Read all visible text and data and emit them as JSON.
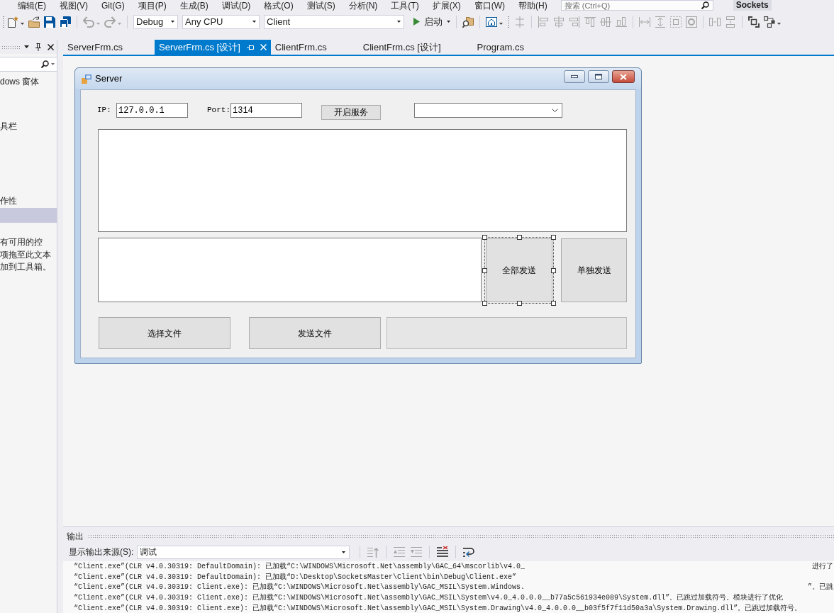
{
  "menu_bar": {
    "items": [
      "编辑(E)",
      "视图(V)",
      "Git(G)",
      "项目(P)",
      "生成(B)",
      "调试(D)",
      "格式(O)",
      "测试(S)",
      "分析(N)",
      "工具(T)",
      "扩展(X)",
      "窗口(W)",
      "帮助(H)"
    ],
    "search": {
      "placeholder": "搜索 (Ctrl+Q)"
    },
    "solution_name": "Sockets"
  },
  "toolbar": {
    "groups": [
      [
        {
          "kind": "new",
          "disabled": false,
          "dropdown": true
        },
        {
          "kind": "open",
          "disabled": false,
          "dropdown": false
        },
        {
          "kind": "save",
          "disabled": false,
          "dropdown": false
        },
        {
          "kind": "saveall",
          "disabled": false,
          "dropdown": false
        }
      ],
      [
        {
          "kind": "undo",
          "disabled": true,
          "dropdown": true
        },
        {
          "kind": "redo",
          "disabled": true,
          "dropdown": true
        }
      ],
      [
        {
          "kind": "config",
          "value": "Debug"
        },
        {
          "kind": "platform",
          "value": "Any CPU"
        },
        {
          "kind": "project",
          "value": "Client"
        },
        {
          "kind": "start",
          "label": "启动",
          "dropdown": true
        }
      ],
      [
        {
          "kind": "find",
          "disabled": false,
          "dropdown": false
        }
      ],
      [
        {
          "kind": "form",
          "disabled": false,
          "dropdown": true
        }
      ],
      [
        {
          "kind": "grid",
          "disabled": true,
          "dropdown": false
        }
      ],
      [
        {
          "kind": "alignleft",
          "disabled": true,
          "dropdown": false
        },
        {
          "kind": "aligncenter",
          "disabled": true,
          "dropdown": false
        },
        {
          "kind": "alignright",
          "disabled": true,
          "dropdown": false
        },
        {
          "kind": "aligntop",
          "disabled": true,
          "dropdown": false
        },
        {
          "kind": "alignmiddle",
          "disabled": true,
          "dropdown": false
        },
        {
          "kind": "alignbottom",
          "disabled": true,
          "dropdown": false
        }
      ],
      [
        {
          "kind": "samewidth",
          "disabled": true,
          "dropdown": false
        },
        {
          "kind": "sameheight",
          "disabled": true,
          "dropdown": false
        },
        {
          "kind": "samesize",
          "disabled": true,
          "dropdown": false
        },
        {
          "kind": "sizegrid",
          "disabled": true,
          "dropdown": false
        }
      ],
      [
        {
          "kind": "spaceh",
          "disabled": true,
          "dropdown": false
        },
        {
          "kind": "spacev",
          "disabled": true,
          "dropdown": false
        }
      ],
      [
        {
          "kind": "expand",
          "disabled": false,
          "dropdown": false
        },
        {
          "kind": "nodes",
          "disabled": false,
          "dropdown": true
        }
      ]
    ]
  },
  "toolbox": {
    "rows": [
      {
        "label": "dows 窗体",
        "selected": false
      },
      {
        "selected": false
      },
      {
        "selected": false
      },
      {
        "label": "具栏",
        "selected": false
      },
      {
        "selected": false
      },
      {
        "selected": false
      },
      {
        "selected": false
      },
      {
        "selected": false
      },
      {
        "label": "作性",
        "selected": false
      },
      {
        "selected": true
      }
    ],
    "empty_message_lines": [
      "有可用的控",
      "项拖至此文本",
      "加到工具箱。"
    ]
  },
  "tabs": [
    {
      "label": "ServerFrm.cs",
      "selected": false
    },
    {
      "label": "ServerFrm.cs [设计]",
      "selected": true
    },
    {
      "label": "ClientFrm.cs",
      "selected": false
    },
    {
      "label": "ClientFrm.cs [设计]",
      "selected": false
    },
    {
      "label": "Program.cs",
      "selected": false
    }
  ],
  "form": {
    "title": "Server",
    "ip_label": "IP:",
    "ip_value": "127.0.0.1",
    "port_label": "Port:",
    "port_value": "1314",
    "start_button": {
      "label": "开启服务",
      "selected": false
    },
    "send_all_button": {
      "label": "全部发送",
      "selected": true
    },
    "send_one_button": {
      "label": "单独发送",
      "selected": false
    },
    "choose_file_button": {
      "label": "选择文件",
      "selected": false
    },
    "send_file_button": {
      "label": "发送文件",
      "selected": false
    },
    "progress": {
      "level": 0
    }
  },
  "output": {
    "title": "输出",
    "source_label": "显示输出来源(S):",
    "source_value": "调试",
    "tools": [
      {
        "kind": "locate",
        "disabled": true
      },
      {
        "kind": "prev",
        "disabled": true
      },
      {
        "kind": "next",
        "disabled": true
      },
      {
        "kind": "clear",
        "disabled": false
      },
      {
        "kind": "wrap",
        "disabled": false
      }
    ],
    "lines": [
      {
        "text": "“Client.exe”(CLR v4.0.30319: DefaultDomain): 已加载“C:\\WINDOWS\\Microsoft.Net\\assembly\\GAC_64\\mscorlib\\v4.0_",
        "tail": "进行了"
      },
      {
        "text": "“Client.exe”(CLR v4.0.30319: DefaultDomain): 已加载“D:\\Desktop\\SocketsMaster\\Client\\bin\\Debug\\Client.exe”"
      },
      {
        "text": "“Client.exe”(CLR v4.0.30319: Client.exe): 已加载“C:\\WINDOWS\\Microsoft.Net\\assembly\\GAC_MSIL\\System.Windows.",
        "tail": "”。已跳"
      },
      {
        "text": "“Client.exe”(CLR v4.0.30319: Client.exe): 已加载“C:\\WINDOWS\\Microsoft.Net\\assembly\\GAC_MSIL\\System\\v4.0_4.0.0.0__b77a5c561934e089\\System.dll”。已跳过加载符号。模块进行了优化"
      },
      {
        "text": "“Client.exe”(CLR v4.0.30319: Client.exe): 已加载“C:\\WINDOWS\\Microsoft.Net\\assembly\\GAC_MSIL\\System.Drawing\\v4.0_4.0.0.0__b03f5f7f11d50a3a\\System.Drawing.dll”。已跳过加载符号。"
      }
    ]
  }
}
